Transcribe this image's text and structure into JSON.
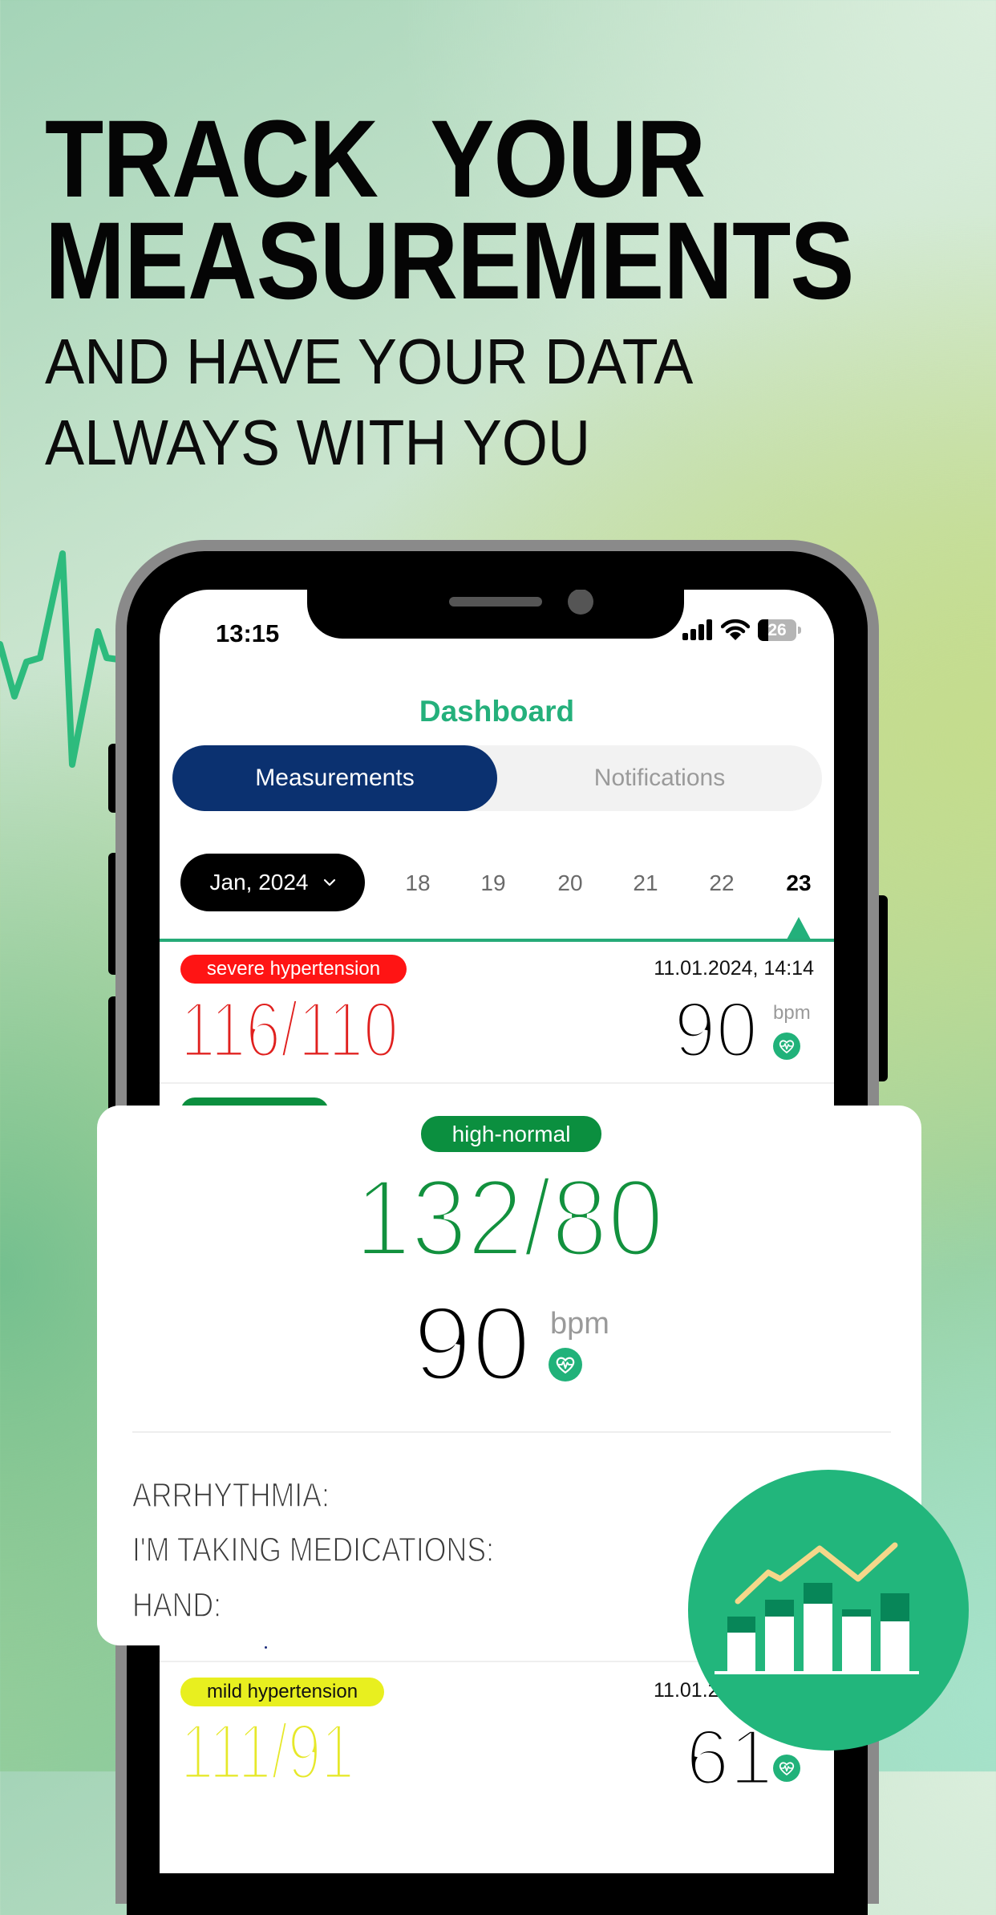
{
  "hero": {
    "title_line1": "TRACK YOUR",
    "title_line2": "MEASUREMENTS",
    "subtitle_line1": "AND HAVE YOUR DATA",
    "subtitle_line2": "ALWAYS WITH YOU"
  },
  "status_bar": {
    "time": "13:15",
    "battery_level": "26",
    "icons": [
      "signal-icon",
      "wifi-icon",
      "battery-icon"
    ]
  },
  "app": {
    "title": "Dashboard",
    "tabs": [
      {
        "label": "Measurements",
        "active": true
      },
      {
        "label": "Notifications",
        "active": false
      }
    ],
    "month_selector": {
      "label": "Jan, 2024",
      "icon": "chevron-down-icon"
    },
    "days": [
      {
        "label": "18"
      },
      {
        "label": "19"
      },
      {
        "label": "20"
      },
      {
        "label": "21"
      },
      {
        "label": "22"
      },
      {
        "label": "23",
        "selected": true
      }
    ],
    "measurements": [
      {
        "status": "severe hypertension",
        "status_color": "#ff1414",
        "status_text_color": "#ffffff",
        "datetime": "11.01.2024, 14:14",
        "pressure": "116/110",
        "pressure_color": "#e0201e",
        "pulse": "90",
        "pulse_unit": "bpm"
      },
      {
        "status_color": "#0b8f3f"
      },
      {
        "status": "mild hypertension",
        "status_color": "#e8ef1f",
        "status_text_color": "#111111",
        "datetime": "11.01.2",
        "pressure": "111/91",
        "pressure_color": "#e6e82a",
        "pulse": "61"
      }
    ]
  },
  "detail_card": {
    "status": "high-normal",
    "status_color": "#0b8f3f",
    "pressure": "132/80",
    "pressure_color": "#12913e",
    "pulse": "90",
    "pulse_unit": "bpm",
    "fields": [
      {
        "label": "ARRHYTHMIA:"
      },
      {
        "label": "I'M TAKING MEDICATIONS:"
      },
      {
        "label": "HAND:"
      }
    ]
  },
  "colors": {
    "brand_green": "#24b07b",
    "tab_active": "#0b3170",
    "circle_green": "#22b67c",
    "circle_dark_green": "#078658",
    "trend_line": "#f5d78a"
  }
}
